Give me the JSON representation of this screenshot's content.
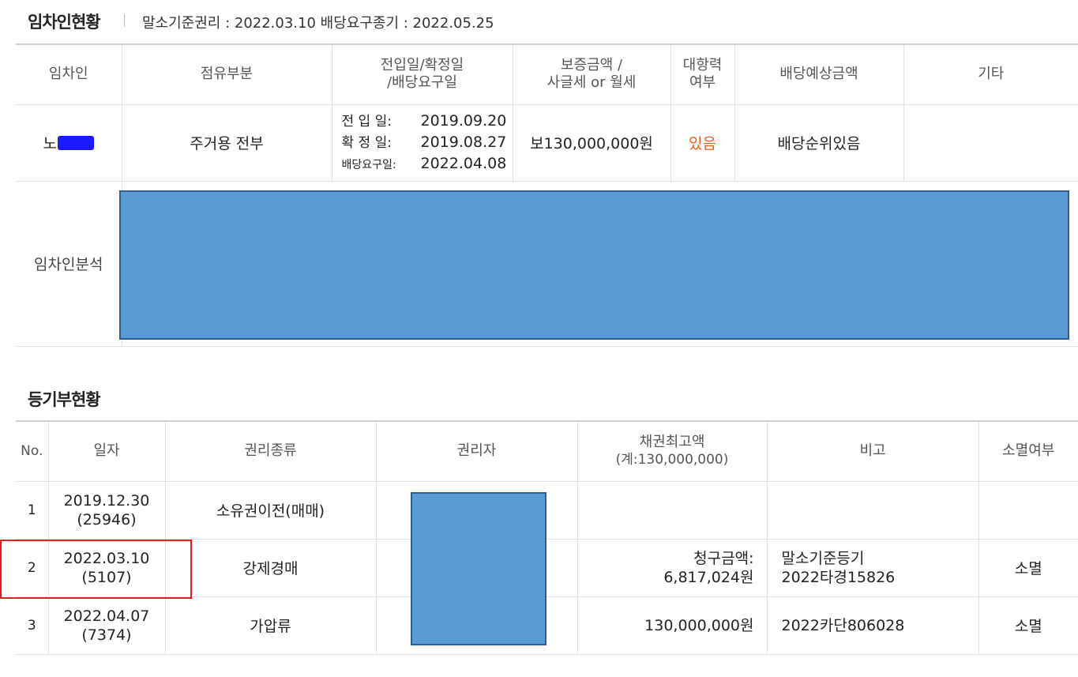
{
  "tenant_section": {
    "title": "임차인현황",
    "info": "말소기준권리 : 2022.03.10   배당요구종기 : 2022.05.25",
    "headers": [
      "임차인",
      "점유부분",
      "전입일/확정일",
      "/배당요구일",
      "보증금액 /",
      "사글세 or 월세",
      "대항력",
      "여부",
      "배당예상금액",
      "기타"
    ],
    "row": {
      "name": "노",
      "occupancy": "주거용 전부",
      "move_in_label": "전 입 일:",
      "move_in": "2019.09.20",
      "fixed_label": "확 정 일:",
      "fixed": "2019.08.27",
      "claim_label": "배당요구일:",
      "claim": "2022.04.08",
      "deposit": "보130,000,000원",
      "opposing_power": "있음",
      "expected_dividend": "배당순위있음",
      "other": ""
    },
    "analysis_label": "임차인분석"
  },
  "registry_section": {
    "title": "등기부현황",
    "headers": {
      "no": "No.",
      "date": "일자",
      "right_type": "권리종류",
      "holder": "권리자",
      "max_amount_1": "채권최고액",
      "max_amount_2": "(계:130,000,000)",
      "note": "비고",
      "extinction": "소멸여부"
    },
    "rows": [
      {
        "no": "1",
        "date": "2019.12.30",
        "receipt": "(25946)",
        "right_type": "소유권이전(매매)",
        "amount_label": "",
        "amount": "",
        "note1": "",
        "note2": "",
        "extinction": ""
      },
      {
        "no": "2",
        "date": "2022.03.10",
        "receipt": "(5107)",
        "right_type": "강제경매",
        "amount_label": "청구금액:",
        "amount": "6,817,024원",
        "note1": "말소기준등기",
        "note2": "2022타경15826",
        "extinction": "소멸"
      },
      {
        "no": "3",
        "date": "2022.04.07",
        "receipt": "(7374)",
        "right_type": "가압류",
        "amount_label": "",
        "amount": "130,000,000원",
        "note1": "2022카단806028",
        "note2": "",
        "extinction": "소멸"
      }
    ]
  },
  "colors": {
    "mask_box": "#5b9bd5",
    "name_mask": "#1a1aff",
    "highlight": "#e02020",
    "accent_text": "#e8631c"
  }
}
